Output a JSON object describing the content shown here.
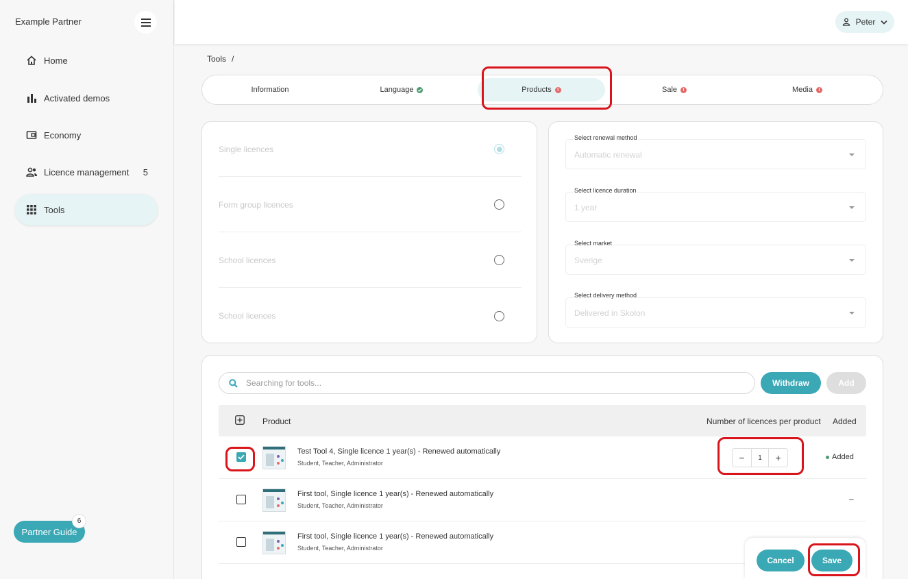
{
  "app": {
    "brand": "Example Partner"
  },
  "sidebar": {
    "items": [
      {
        "label": "Home",
        "icon": "home-icon"
      },
      {
        "label": "Activated demos",
        "icon": "bar-chart-icon"
      },
      {
        "label": "Economy",
        "icon": "wallet-icon"
      },
      {
        "label": "Licence management",
        "icon": "people-icon",
        "count": "5"
      },
      {
        "label": "Tools",
        "icon": "grid-icon",
        "active": true
      }
    ],
    "partner_guide": {
      "label": "Partner Guide",
      "badge": "6"
    }
  },
  "topbar": {
    "user": "Peter"
  },
  "breadcrumb": {
    "root": "Tools",
    "separator": "/"
  },
  "tabs": [
    {
      "label": "Information",
      "status": "none"
    },
    {
      "label": "Language",
      "status": "ok"
    },
    {
      "label": "Products",
      "status": "error",
      "active": true
    },
    {
      "label": "Sale",
      "status": "error"
    },
    {
      "label": "Media",
      "status": "error"
    }
  ],
  "licence_types": [
    {
      "label": "Single licences",
      "selected": true
    },
    {
      "label": "Form group licences",
      "selected": false
    },
    {
      "label": "School licences",
      "selected": false
    },
    {
      "label": "School licences",
      "selected": false
    }
  ],
  "selects": [
    {
      "label": "Select renewal method",
      "value": "Automatic renewal"
    },
    {
      "label": "Select licence duration",
      "value": "1 year"
    },
    {
      "label": "Select market",
      "value": "Sverige"
    },
    {
      "label": "Select delivery method",
      "value": "Delivered in Skolon"
    }
  ],
  "products": {
    "search_placeholder": "Searching for tools...",
    "withdraw_label": "Withdraw",
    "add_label": "Add",
    "columns": {
      "product": "Product",
      "licences": "Number of licences per product",
      "added": "Added"
    },
    "rows": [
      {
        "name": "Test Tool 4, Single licence 1 year(s) - Renewed automatically",
        "roles": "Student, Teacher, Administrator",
        "checked": true,
        "quantity": "1",
        "status": "Added"
      },
      {
        "name": "First tool, Single licence 1 year(s) - Renewed automatically",
        "roles": "Student, Teacher, Administrator",
        "checked": false,
        "status": "–"
      },
      {
        "name": "First tool, Single licence 1 year(s) - Renewed automatically",
        "roles": "Student, Teacher, Administrator",
        "checked": false,
        "status": ""
      }
    ]
  },
  "actions": {
    "cancel_label": "Cancel",
    "save_label": "Save"
  },
  "colors": {
    "accent": "#3aa8b5",
    "active_bg": "#e6f4f5",
    "ok": "#4a9d6f",
    "error": "#e56b6b",
    "highlight": "#d9141b"
  }
}
